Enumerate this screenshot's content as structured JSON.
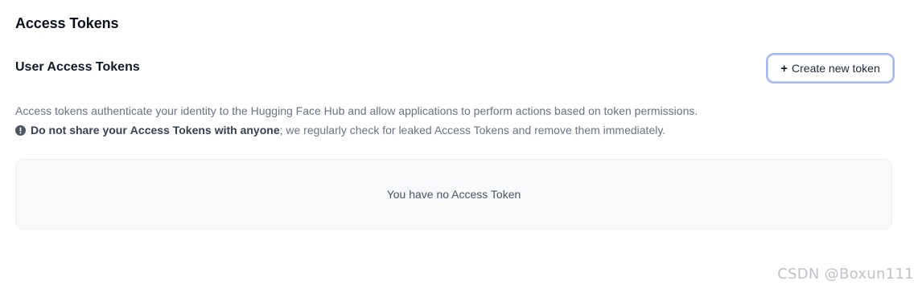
{
  "page": {
    "title": "Access Tokens"
  },
  "section": {
    "title": "User Access Tokens",
    "create_button": {
      "icon": "plus-icon",
      "plus": "+",
      "label": "Create new token"
    }
  },
  "description": "Access tokens authenticate your identity to the Hugging Face Hub and allow applications to perform actions based on token permissions.",
  "warning": {
    "icon": "info-circle-icon",
    "bold_prefix_part1": "Do not share your ",
    "bold_prefix_part2": "Access Tokens",
    "bold_prefix_part3": " with anyone",
    "rest": "; we regularly check for leaked Access Tokens and remove them immediately."
  },
  "tokens": {
    "empty_message": "You have no Access Token"
  },
  "watermark": "CSDN @Boxun111"
}
